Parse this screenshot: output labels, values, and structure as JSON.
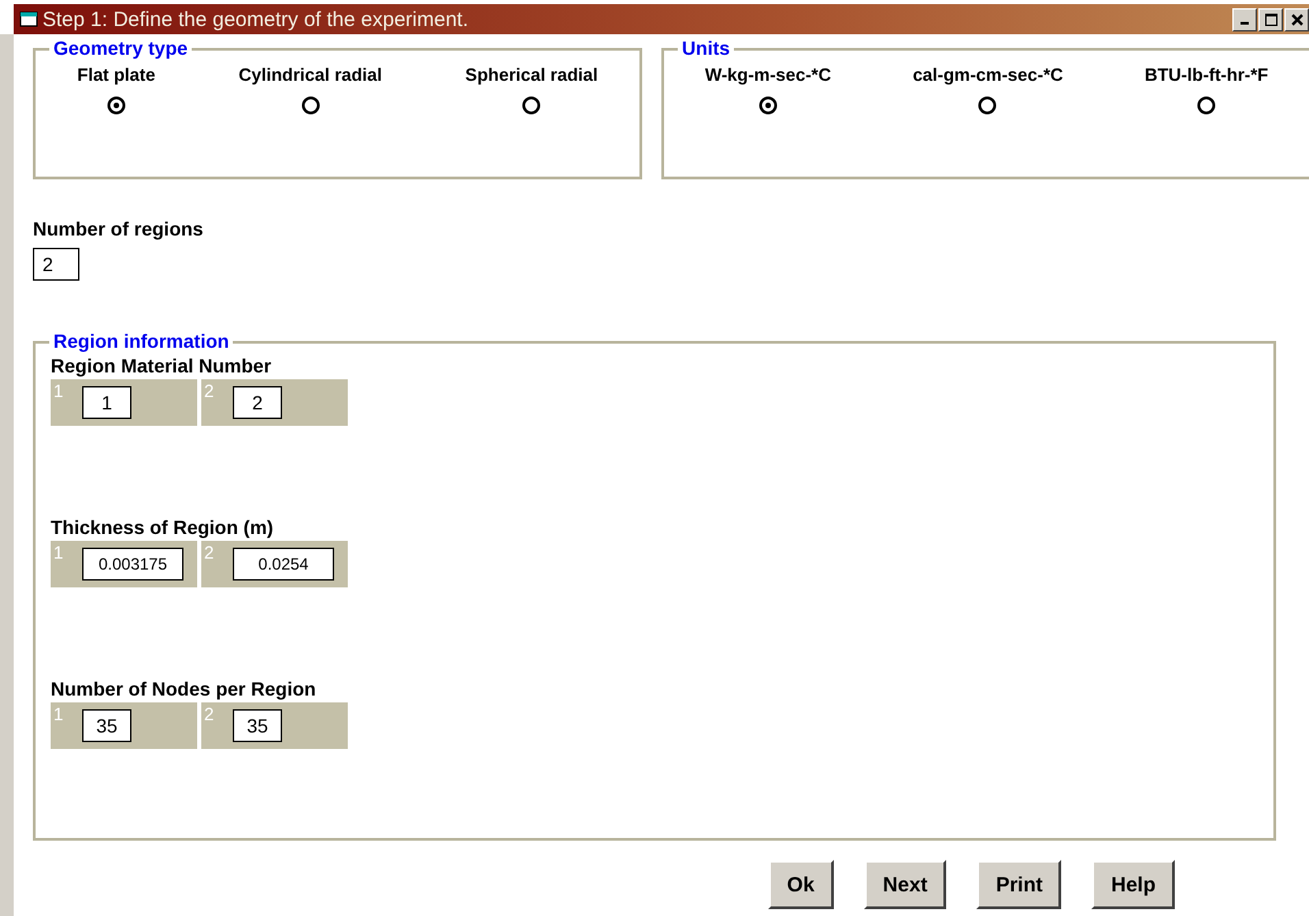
{
  "window": {
    "title": "Step 1: Define the geometry of the experiment."
  },
  "geometry_type": {
    "legend": "Geometry type",
    "options": [
      {
        "label": "Flat plate",
        "selected": true
      },
      {
        "label": "Cylindrical radial",
        "selected": false
      },
      {
        "label": "Spherical radial",
        "selected": false
      }
    ]
  },
  "units": {
    "legend": "Units",
    "options": [
      {
        "label": "W-kg-m-sec-*C",
        "selected": true
      },
      {
        "label": "cal-gm-cm-sec-*C",
        "selected": false
      },
      {
        "label": "BTU-lb-ft-hr-*F",
        "selected": false
      }
    ]
  },
  "number_of_regions": {
    "label": "Number of regions",
    "value": "2"
  },
  "region_information": {
    "legend": "Region information",
    "sections": [
      {
        "label": "Region Material Number",
        "cells": [
          {
            "index": "1",
            "value": "1"
          },
          {
            "index": "2",
            "value": "2"
          }
        ]
      },
      {
        "label": "Thickness of Region (m)",
        "cells": [
          {
            "index": "1",
            "value": "0.003175"
          },
          {
            "index": "2",
            "value": "0.0254"
          }
        ]
      },
      {
        "label": "Number of Nodes per Region",
        "cells": [
          {
            "index": "1",
            "value": "35"
          },
          {
            "index": "2",
            "value": "35"
          }
        ]
      }
    ]
  },
  "buttons": [
    "Ok",
    "Next",
    "Print",
    "Help"
  ]
}
